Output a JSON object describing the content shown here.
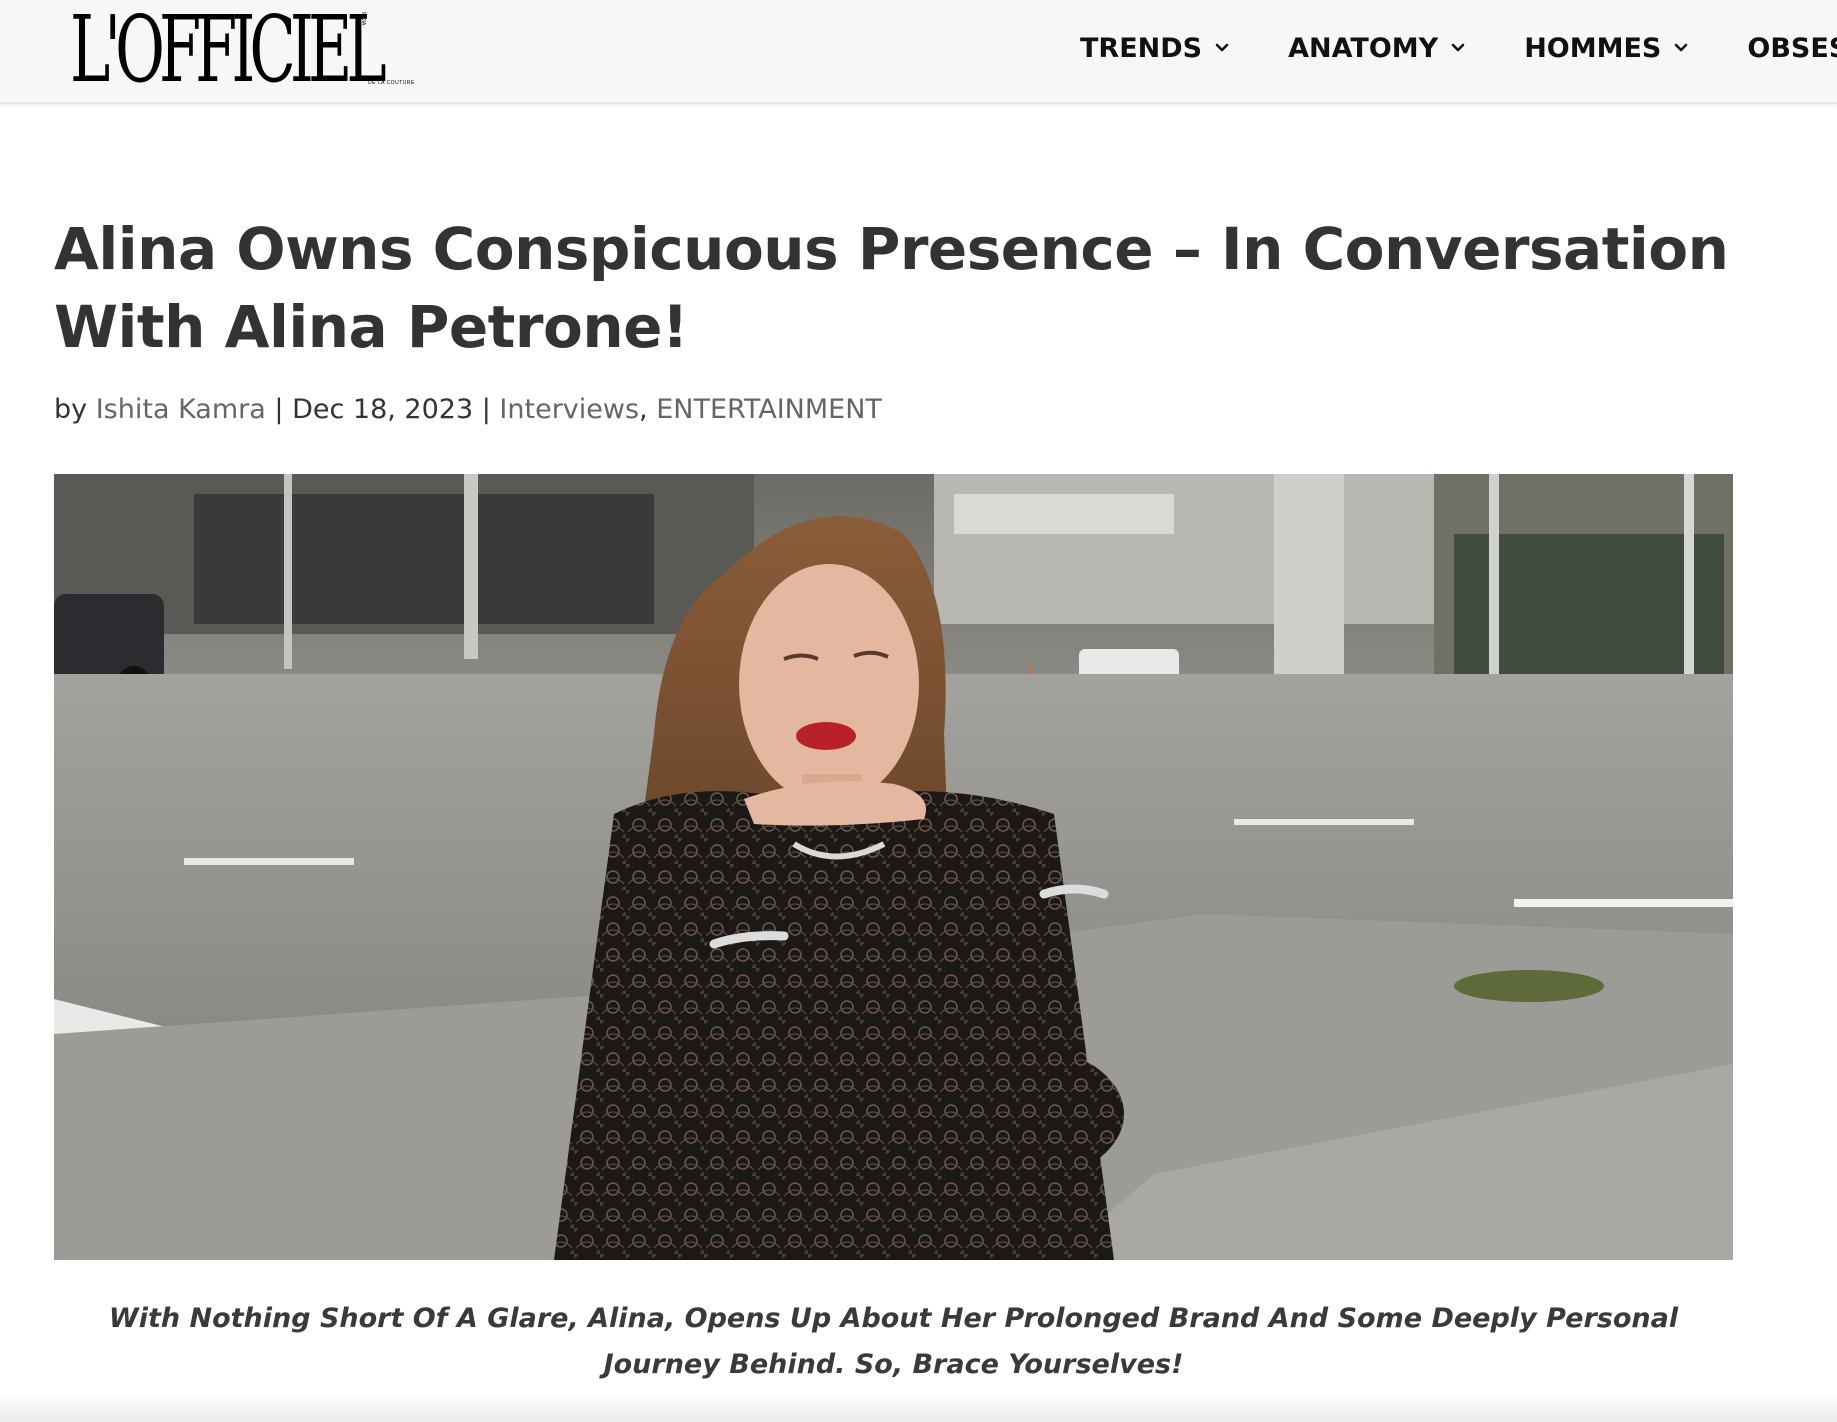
{
  "header": {
    "logo": "L'OFFICIEL",
    "logo_sub": "DE LA COUTURE",
    "logo_side": "INDIA",
    "nav": [
      {
        "label": "TRENDS",
        "icon": "chevron-down-icon"
      },
      {
        "label": "ANATOMY",
        "icon": "chevron-down-icon"
      },
      {
        "label": "HOMMES",
        "icon": "chevron-down-icon"
      },
      {
        "label": "OBSESS"
      }
    ]
  },
  "article": {
    "title": "Alina Owns Conspicuous Presence – In Conversation With Alina Petrone!",
    "meta": {
      "by": "by",
      "author": "Ishita Kamra",
      "sep1": " | ",
      "date": "Dec 18, 2023",
      "sep2": " | ",
      "category1": "Interviews",
      "comma": ", ",
      "category2": "ENTERTAINMENT"
    },
    "caption": "With Nothing Short Of A Glare, Alina, Opens Up About Her Prolonged Brand And Some Deeply Personal Journey Behind. So, Brace Yourselves!"
  },
  "colors": {
    "header_bg": "#f7f7f7",
    "text_dark": "#333333",
    "link_gray": "#666666",
    "nav_text": "#111111"
  }
}
